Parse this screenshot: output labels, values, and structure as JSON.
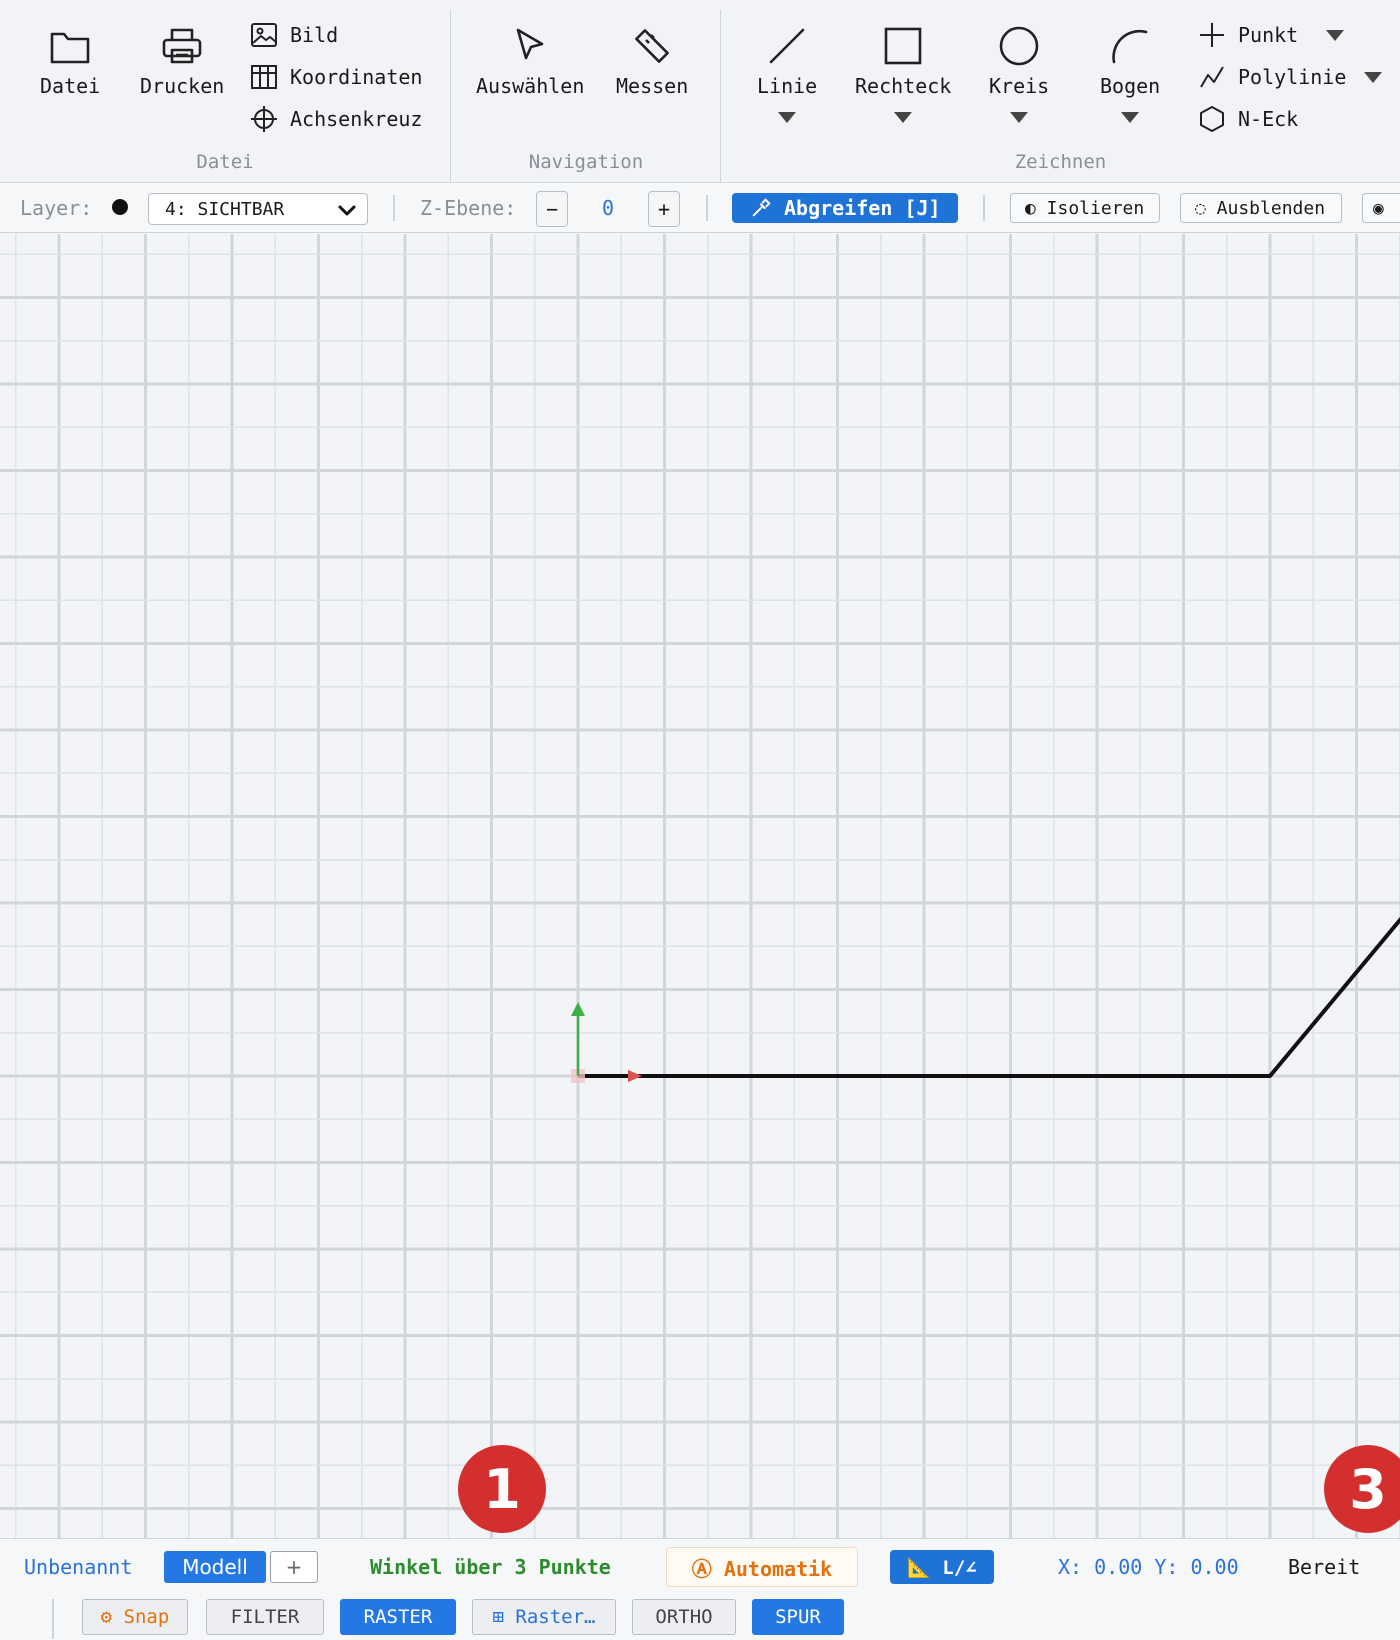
{
  "ribbon": {
    "groups": {
      "file": "Datei",
      "navigation": "Navigation",
      "draw": "Zeichnen"
    },
    "file_group": {
      "open_label": "Datei",
      "print_label": "Drucken",
      "image_label": "Bild",
      "coordinates_label": "Koordinaten",
      "crosshair_label": "Achsenkreuz"
    },
    "navigation_group": {
      "select_label": "Auswählen",
      "measure_label": "Messen"
    },
    "draw_group": {
      "line_label": "Linie",
      "rectangle_label": "Rechteck",
      "circle_label": "Kreis",
      "arc_label": "Bogen",
      "point_label": "Punkt",
      "polyline_label": "Polylinie",
      "polygon_label": "N-Eck"
    }
  },
  "layerbar": {
    "layer_label": "Layer:",
    "layer_value": "4: SICHTBAR",
    "zlevel_label": "Z-Ebene:",
    "zlevel_minus": "−",
    "zlevel_value": "0",
    "zlevel_plus": "+",
    "pick_label": "Abgreifen [J]",
    "isolate_label": "◐ Isolieren",
    "hide_label": "◌ Ausblenden",
    "more_label": "◉"
  },
  "canvas": {
    "badge_1": "1",
    "badge_3": "3",
    "colors": {
      "grid_minor": "#dfe2e6",
      "grid_major": "#d2d5da",
      "line": "#111111",
      "axis_x": "#d9534f",
      "axis_y": "#3fae49"
    }
  },
  "statusbar": {
    "document_name": "Unbenannt",
    "model_tab": "Modell",
    "add_tab": "+",
    "command_hint": "Winkel über 3 Punkte",
    "auto_mode": "Ⓐ Automatik",
    "length_angle": "📐 L/∠",
    "coordinates": "X: 0.00 Y: 0.00",
    "state": "Bereit",
    "toggles": {
      "snap": "⚙ Snap",
      "filter": "FILTER",
      "raster": "RASTER",
      "raster_settings": "⊞ Raster…",
      "ortho": "ORTHO",
      "track": "SPUR"
    }
  }
}
